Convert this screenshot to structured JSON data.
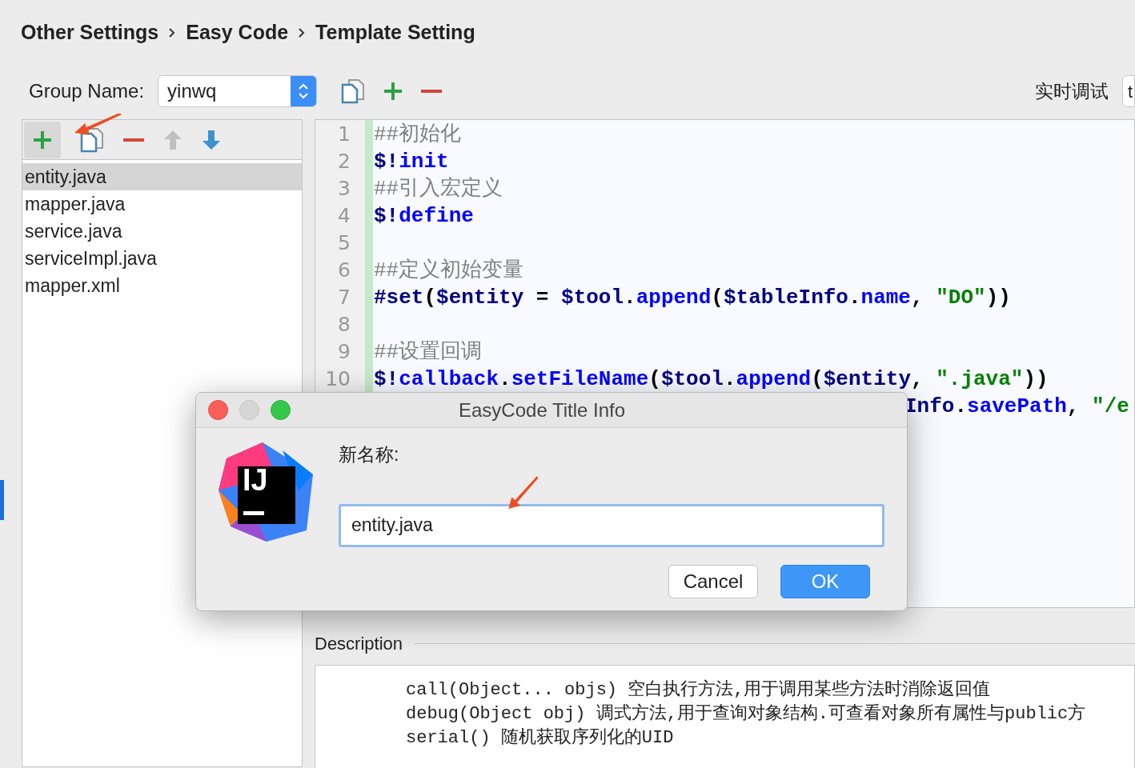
{
  "breadcrumb": [
    "Other Settings",
    "Easy Code",
    "Template Setting"
  ],
  "group": {
    "label": "Group Name:",
    "value": "yinwq"
  },
  "debug_label": "实时调试",
  "debug_button": "t",
  "templates": [
    {
      "name": "entity.java",
      "selected": true
    },
    {
      "name": "mapper.java",
      "selected": false
    },
    {
      "name": "service.java",
      "selected": false
    },
    {
      "name": "serviceImpl.java",
      "selected": false
    },
    {
      "name": "mapper.xml",
      "selected": false
    }
  ],
  "editor": {
    "lines": [
      {
        "number": "1",
        "tokens": [
          {
            "kind": "comment",
            "text": "##初始化"
          }
        ]
      },
      {
        "number": "2",
        "tokens": [
          {
            "kind": "directive",
            "text": "$!"
          },
          {
            "kind": "keyword",
            "text": "init"
          }
        ]
      },
      {
        "number": "3",
        "tokens": [
          {
            "kind": "comment",
            "text": "##引入宏定义"
          }
        ]
      },
      {
        "number": "4",
        "tokens": [
          {
            "kind": "directive",
            "text": "$!"
          },
          {
            "kind": "keyword",
            "text": "define"
          }
        ]
      },
      {
        "number": "5"
      },
      {
        "number": "6",
        "tokens": [
          {
            "kind": "comment",
            "text": "##定义初始变量"
          }
        ]
      },
      {
        "number": "7",
        "tokens": [
          {
            "kind": "directive",
            "text": "#set"
          },
          {
            "kind": "plain",
            "text": "("
          },
          {
            "kind": "variable",
            "text": "$entity"
          },
          {
            "kind": "plain",
            "text": " = "
          },
          {
            "kind": "variable",
            "text": "$tool"
          },
          {
            "kind": "plain",
            "text": "."
          },
          {
            "kind": "keyword",
            "text": "append"
          },
          {
            "kind": "plain",
            "text": "("
          },
          {
            "kind": "variable",
            "text": "$tableInfo"
          },
          {
            "kind": "plain",
            "text": "."
          },
          {
            "kind": "keyword",
            "text": "name"
          },
          {
            "kind": "plain",
            "text": ", "
          },
          {
            "kind": "string",
            "text": "\"DO\""
          },
          {
            "kind": "plain",
            "text": "))"
          }
        ]
      },
      {
        "number": "8"
      },
      {
        "number": "9",
        "tokens": [
          {
            "kind": "comment",
            "text": "##设置回调"
          }
        ]
      },
      {
        "number": "10",
        "tokens": [
          {
            "kind": "directive",
            "text": "$!"
          },
          {
            "kind": "keyword",
            "text": "callback"
          },
          {
            "kind": "plain",
            "text": "."
          },
          {
            "kind": "keyword",
            "text": "setFileName"
          },
          {
            "kind": "plain",
            "text": "("
          },
          {
            "kind": "variable",
            "text": "$tool"
          },
          {
            "kind": "plain",
            "text": "."
          },
          {
            "kind": "keyword",
            "text": "append"
          },
          {
            "kind": "plain",
            "text": "("
          },
          {
            "kind": "variable",
            "text": "$entity"
          },
          {
            "kind": "plain",
            "text": ", "
          },
          {
            "kind": "string",
            "text": "\".java\""
          },
          {
            "kind": "plain",
            "text": "))"
          }
        ]
      },
      {
        "tokens": [
          {
            "kind": "variable",
            "text": "Info"
          },
          {
            "kind": "plain",
            "text": "."
          },
          {
            "kind": "keyword",
            "text": "savePath"
          },
          {
            "kind": "plain",
            "text": ", "
          },
          {
            "kind": "string",
            "text": "\"/e"
          }
        ]
      }
    ]
  },
  "description": {
    "title": "Description",
    "lines": [
      "call(Object... objs) 空白执行方法,用于调用某些方法时消除返回值",
      "debug(Object obj) 调式方法,用于查询对象结构.可查看对象所有属性与public方",
      "serial() 随机获取序列化的UID"
    ]
  },
  "dialog": {
    "title": "EasyCode Title Info",
    "logo_text": "IJ",
    "label": "新名称:",
    "value": "entity.java",
    "buttons": [
      {
        "label": "Cancel",
        "default": false
      },
      {
        "label": "OK",
        "default": true
      }
    ]
  }
}
